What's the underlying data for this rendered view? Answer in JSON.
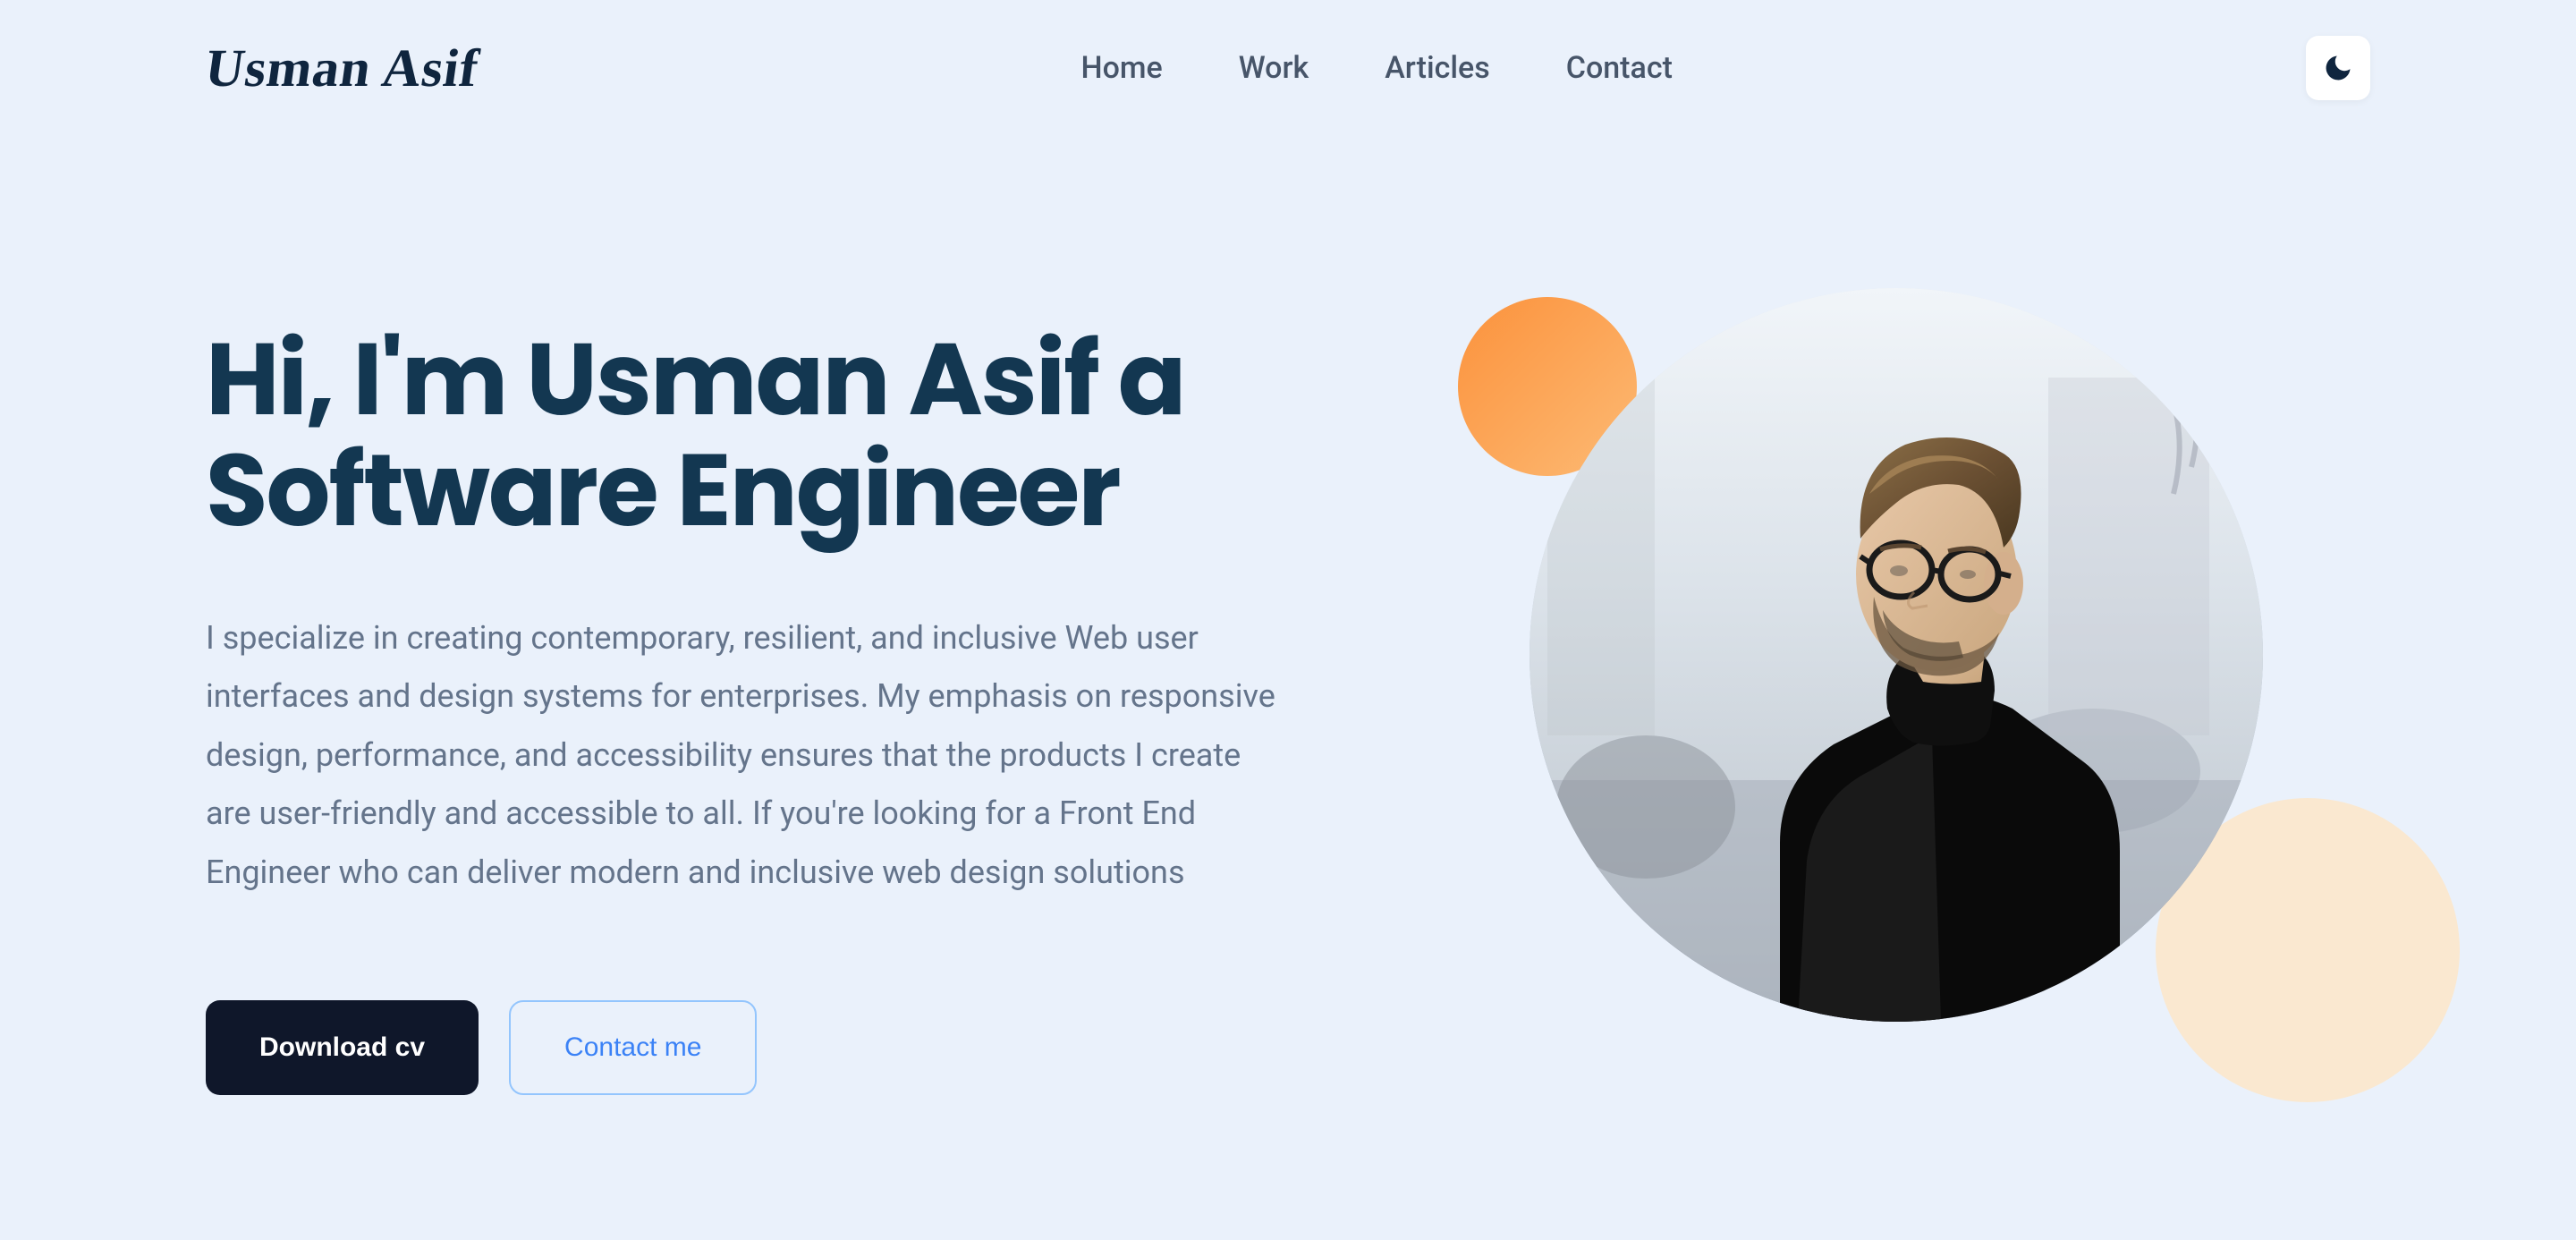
{
  "header": {
    "logo": "Usman Asif",
    "nav": [
      {
        "label": "Home"
      },
      {
        "label": "Work"
      },
      {
        "label": "Articles"
      },
      {
        "label": "Contact"
      }
    ]
  },
  "hero": {
    "title": "Hi, I'm Usman Asif a Software Engineer",
    "description": "I specialize in creating contemporary, resilient, and inclusive Web user interfaces and design systems for enterprises. My emphasis on responsive design, performance, and accessibility ensures that the products I create are user-friendly and accessible to all. If you're looking for a Front End Engineer who can deliver modern and inclusive web design solutions",
    "download_label": "Download cv",
    "contact_label": "Contact me"
  }
}
